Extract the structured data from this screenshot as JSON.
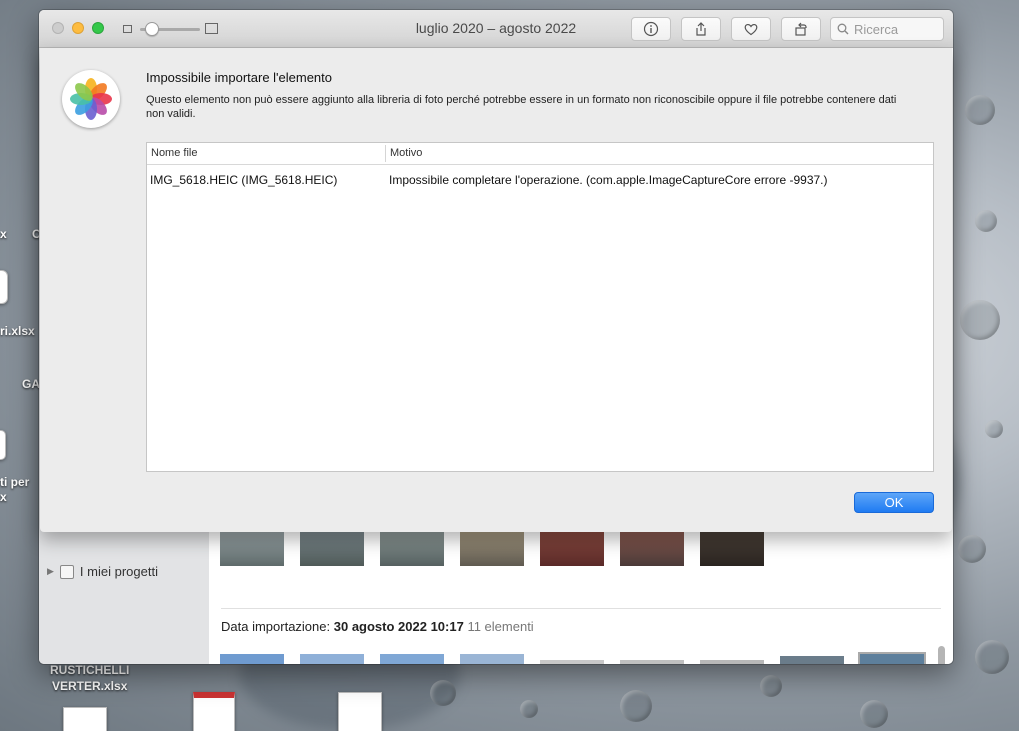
{
  "desktop": {
    "labels": [
      "x",
      "C",
      "ri.xlsx",
      "GA",
      "ti per",
      "x"
    ],
    "bottom_file": [
      "RUSTICHELLI",
      "VERTER.xlsx"
    ]
  },
  "window": {
    "title": "luglio 2020 – agosto 2022",
    "toolbar": {
      "info_icon": "info-icon",
      "share_icon": "share-icon",
      "favorite_icon": "heart-icon",
      "rotate_icon": "rotate-icon",
      "search_placeholder": "Ricerca"
    },
    "sidebar": {
      "visible_item": "I miei progetti"
    },
    "import_section": {
      "label": "Data importazione:",
      "date": "30 agosto 2022 10:17",
      "count": "11 elementi"
    }
  },
  "dialog": {
    "title": "Impossibile importare l'elemento",
    "message": "Questo elemento non può essere aggiunto alla libreria di foto perché potrebbe essere in un formato non riconoscibile oppure il file potrebbe contenere dati non validi.",
    "table": {
      "columns": [
        "Nome file",
        "Motivo"
      ],
      "rows": [
        {
          "file": "IMG_5618.HEIC (IMG_5618.HEIC)",
          "reason": "Impossibile completare l'operazione. (com.apple.ImageCaptureCore errore -9937.)"
        }
      ]
    },
    "ok_label": "OK"
  },
  "colors": {
    "accent": "#1f7bf2",
    "close": "#cdcdcd",
    "minimize": "#fdbc40",
    "zoom": "#34c84a"
  }
}
